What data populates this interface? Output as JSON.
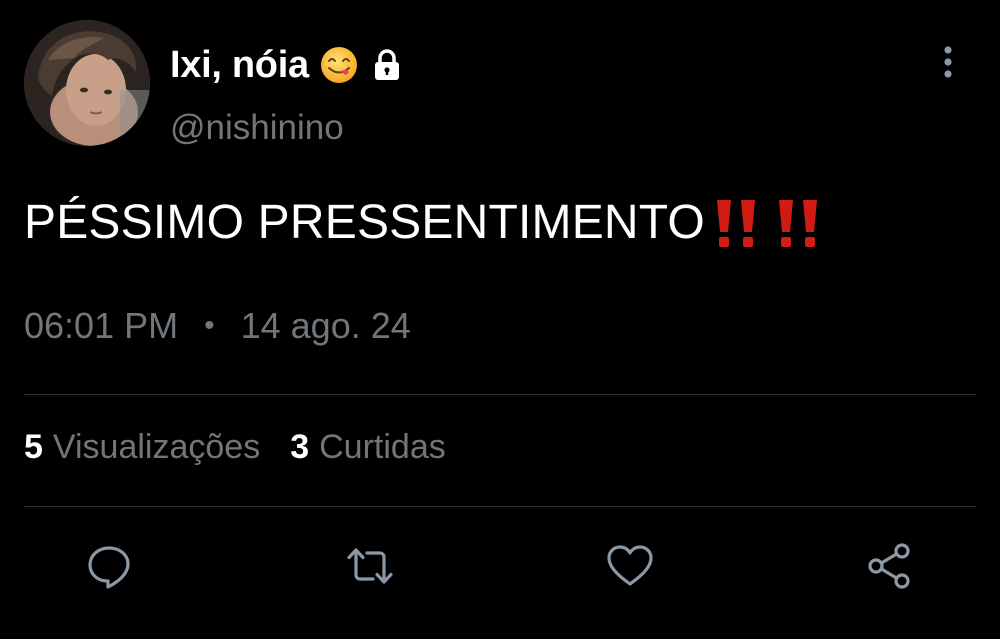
{
  "author": {
    "display_name": "Ixi, nóia",
    "handle": "@nishinino",
    "name_emoji": "face-savoring-food-icon",
    "protected_icon": "lock-icon"
  },
  "tweet": {
    "text": "PÉSSIMO PRESSENTIMENTO",
    "trailing_emojis": [
      "double-exclamation-icon",
      "double-exclamation-icon"
    ],
    "time": "06:01 PM",
    "separator": "•",
    "date": "14 ago. 24"
  },
  "stats": {
    "views_count": "5",
    "views_label": "Visualizações",
    "likes_count": "3",
    "likes_label": "Curtidas"
  },
  "actions": [
    "reply-icon",
    "retweet-icon",
    "like-icon",
    "share-icon"
  ],
  "colors": {
    "background": "#000000",
    "primary_text": "#ffffff",
    "secondary_text": "#71767b",
    "divider": "#2f3336",
    "icon": "#8b98a5",
    "emoji_red": "#d01c14"
  }
}
